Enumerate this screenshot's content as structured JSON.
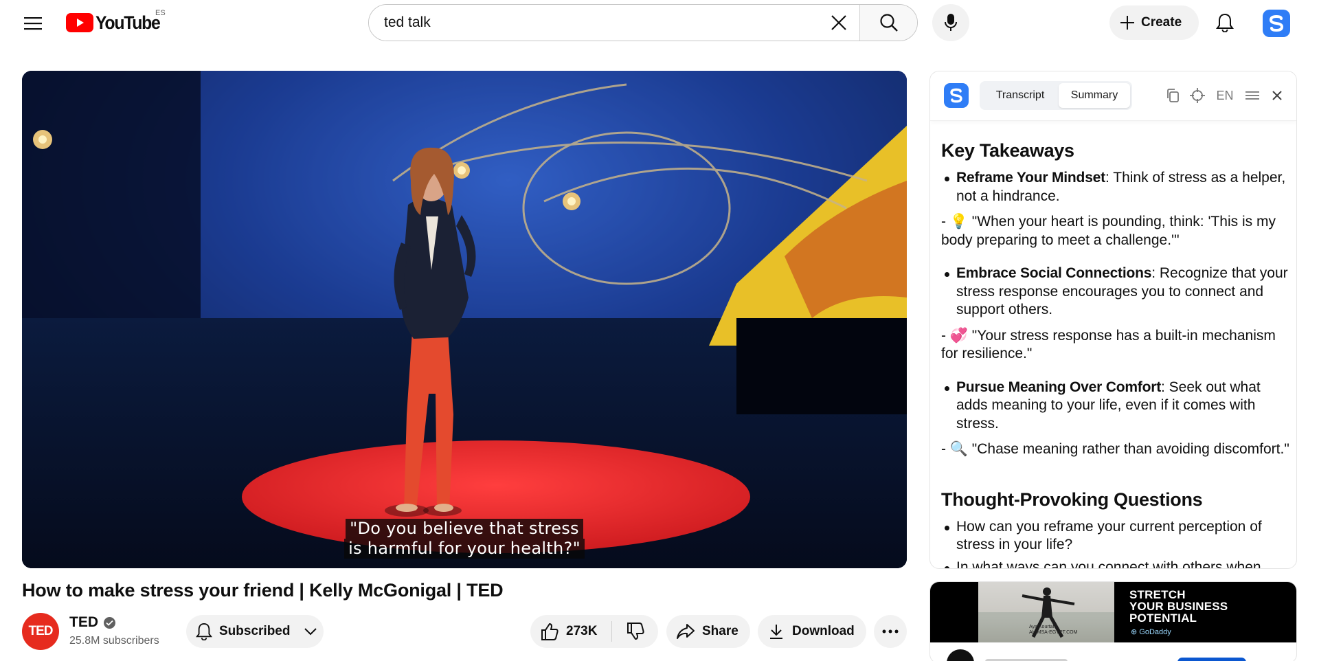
{
  "header": {
    "logo_text": "YouTube",
    "country_code": "ES",
    "search_value": "ted talk",
    "create_label": "Create"
  },
  "video": {
    "caption_line1": "\"Do you believe that stress",
    "caption_line2": "is harmful for your health?\"",
    "title": "How to make stress your friend | Kelly McGonigal | TED"
  },
  "channel": {
    "avatar_text": "TED",
    "name": "TED",
    "subscribers": "25.8M subscribers",
    "subscribed_label": "Subscribed"
  },
  "actions": {
    "likes": "273K",
    "share_label": "Share",
    "download_label": "Download"
  },
  "panel": {
    "tabs": [
      "Transcript",
      "Summary"
    ],
    "lang": "EN",
    "section1_title": "Key Takeaways",
    "items": [
      {
        "bold": "Reframe Your Mindset",
        "text": ": Think of stress as a helper, not a hindrance.",
        "quote": "- 💡 \"When your heart is pounding, think: 'This is my body preparing to meet a challenge.'\""
      },
      {
        "bold": "Embrace Social Connections",
        "text": ": Recognize that your stress response encourages you to connect and support others.",
        "quote": "- 💞 \"Your stress response has a built-in mechanism for resilience.\""
      },
      {
        "bold": "Pursue Meaning Over Comfort",
        "text": ": Seek out what adds meaning to your life, even if it comes with stress.",
        "quote": "- 🔍 \"Chase meaning rather than avoiding discomfort.\""
      }
    ],
    "section2_title": "Thought-Provoking Questions",
    "questions": [
      "How can you reframe your current perception of stress in your life?",
      "In what ways can you connect with others when stressed?"
    ]
  },
  "ad": {
    "headline": [
      "STRETCH",
      "YOUR BUSINESS",
      "POTENTIAL"
    ],
    "brand": "GoDaddy",
    "credit": [
      "Aya Kourtam",
      "AHIMSA-EGYPT.COM"
    ]
  }
}
